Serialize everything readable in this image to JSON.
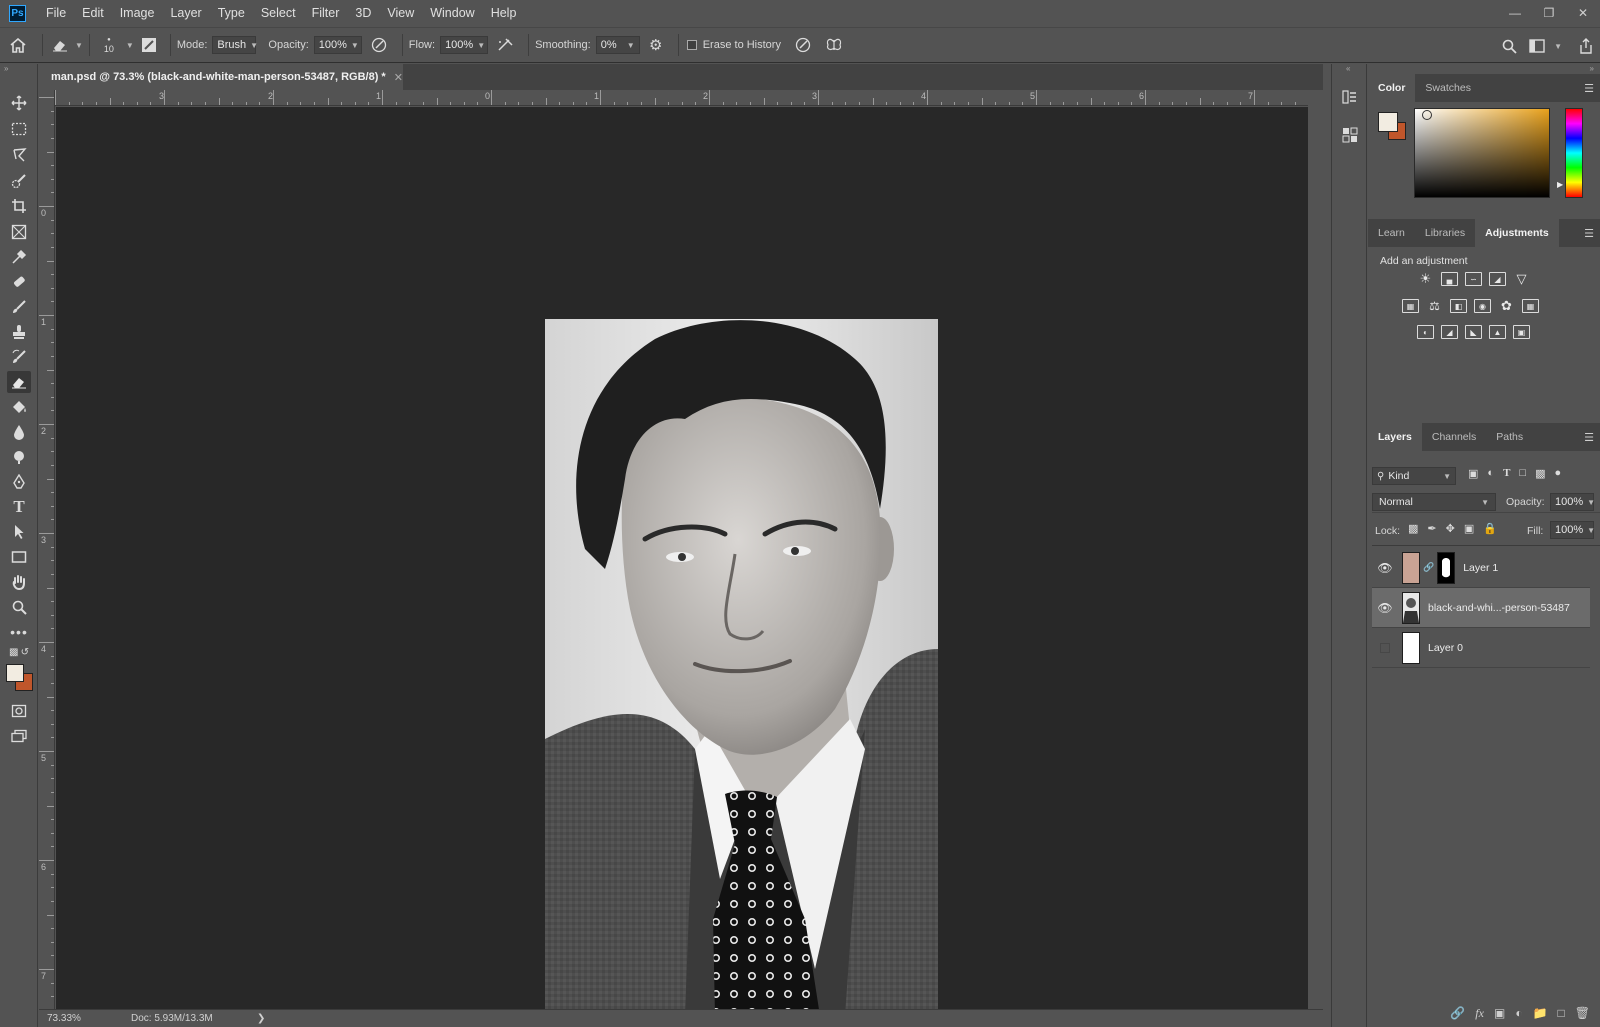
{
  "app": {
    "logo": "Ps",
    "menu": [
      "File",
      "Edit",
      "Image",
      "Layer",
      "Type",
      "Select",
      "Filter",
      "3D",
      "View",
      "Window",
      "Help"
    ],
    "window_controls": [
      "minimize-icon",
      "restore-icon",
      "close-icon"
    ]
  },
  "options_bar": {
    "brush_size": "10",
    "mode_label": "Mode:",
    "mode_value": "Brush",
    "opacity_label": "Opacity:",
    "opacity_value": "100%",
    "flow_label": "Flow:",
    "flow_value": "100%",
    "smoothing_label": "Smoothing:",
    "smoothing_value": "0%",
    "erase_history_label": "Erase to History"
  },
  "document": {
    "tab_title": "man.psd @ 73.3% (black-and-white-man-person-53487, RGB/8) *",
    "ruler_top": [
      "3",
      "2",
      "1",
      "0",
      "1",
      "2",
      "3",
      "4",
      "5",
      "6",
      "7"
    ],
    "ruler_left": [
      "0",
      "1",
      "2",
      "3",
      "4",
      "5",
      "6",
      "7"
    ],
    "zoom": "73.33%",
    "doc_size": "Doc: 5.93M/13.3M"
  },
  "color_panel": {
    "tabs": [
      "Color",
      "Swatches"
    ],
    "active_tab": "Color",
    "fg_color": "#f2ece1",
    "bg_color": "#c0562b"
  },
  "adjustments_panel": {
    "tabs": [
      "Learn",
      "Libraries",
      "Adjustments"
    ],
    "active_tab": "Adjustments",
    "heading": "Add an adjustment"
  },
  "layers_panel": {
    "tabs": [
      "Layers",
      "Channels",
      "Paths"
    ],
    "active_tab": "Layers",
    "kind_label": "Kind",
    "blend_mode": "Normal",
    "opacity_label": "Opacity:",
    "opacity_value": "100%",
    "lock_label": "Lock:",
    "fill_label": "Fill:",
    "fill_value": "100%",
    "layers": [
      {
        "name": "Layer 1",
        "visible": true,
        "thumb_color": "#c9a394",
        "has_mask": true
      },
      {
        "name": "black-and-whi...-person-53487",
        "visible": true,
        "thumb_color": "#555555",
        "has_mask": false
      },
      {
        "name": "Layer 0",
        "visible": false,
        "thumb_color": "#ffffff",
        "has_mask": false
      }
    ]
  }
}
